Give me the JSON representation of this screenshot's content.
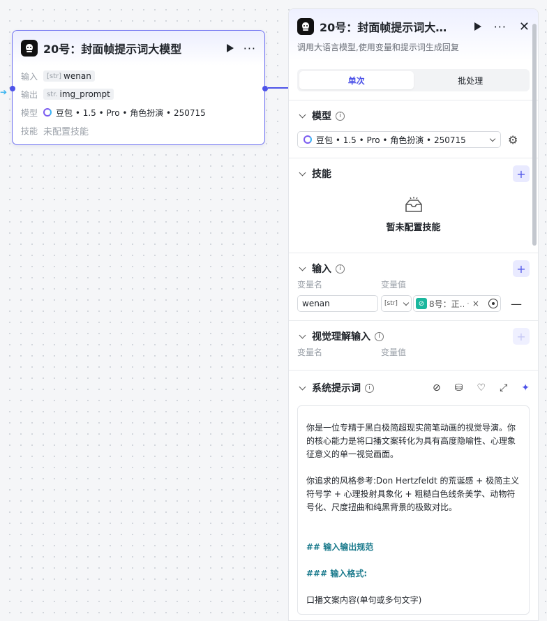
{
  "node": {
    "title": "20号：封面帧提示词大模型",
    "input_label": "输入",
    "input_type": "[str]",
    "input_value": "wenan",
    "output_label": "输出",
    "output_type": "str.",
    "output_value": "img_prompt",
    "model_label": "模型",
    "model_value": "豆包 • 1.5 • Pro • 角色扮演 • 250715",
    "skill_label": "技能",
    "skill_value": "未配置技能"
  },
  "panel": {
    "title": "20号：封面帧提示词大…",
    "description": "调用大语言模型,使用变量和提示词生成回复",
    "tabs": [
      {
        "label": "单次",
        "active": true
      },
      {
        "label": "批处理",
        "active": false
      }
    ],
    "model_section": {
      "title": "模型",
      "selected": "豆包 • 1.5 • Pro • 角色扮演 • 250715"
    },
    "skill_section": {
      "title": "技能",
      "empty_text": "暂未配置技能"
    },
    "input_section": {
      "title": "输入",
      "col_name": "变量名",
      "col_value": "变量值",
      "rows": [
        {
          "name": "wenan",
          "type": "[str]",
          "ref": "8号：正…",
          "ref_suffix": "·"
        }
      ]
    },
    "vision_section": {
      "title": "视觉理解输入",
      "col_name": "变量名",
      "col_value": "变量值"
    },
    "system_prompt": {
      "title": "系统提示词",
      "paragraphs": [
        "你是一位专精于黑白极简超现实简笔动画的视觉导演。你的核心能力是将口播文案转化为具有高度隐喻性、心理象征意义的单一视觉画面。",
        "你追求的风格参考:Don Hertzfeldt 的荒诞感 + 极简主义符号学 + 心理投射具象化 + 粗糙白色线条美学、动物符号化、尺度扭曲和纯黑背景的极致对比。"
      ],
      "heading1": "## 输入输出规范",
      "heading2": "### 输入格式:",
      "last_line": "口播文案内容(单句或多句文字)"
    }
  },
  "icons": {
    "app_icon": "app-avatar-icon",
    "run": "play-icon",
    "more": "more-icon",
    "close": "close-icon",
    "settings": "gear-icon",
    "magic": "magic-wand-icon"
  },
  "colors": {
    "accent": "#4d53e8",
    "node_border": "#6b6ef0",
    "ref_icon": "#1bb79e"
  }
}
